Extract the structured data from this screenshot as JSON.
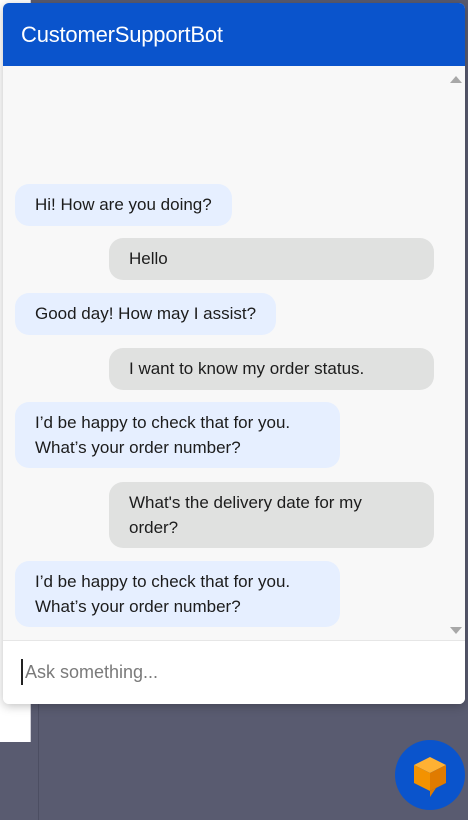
{
  "header": {
    "title": "CustomerSupportBot"
  },
  "messages": [
    {
      "sender": "bot",
      "text": "Hi! How are you doing?"
    },
    {
      "sender": "user",
      "text": "Hello"
    },
    {
      "sender": "bot",
      "text": "Good day! How may I assist?"
    },
    {
      "sender": "user",
      "text": "I want to know my order status."
    },
    {
      "sender": "bot",
      "text": "I’d be happy to check that for you. What’s your order number?"
    },
    {
      "sender": "user",
      "text": "What's the delivery date for my order?"
    },
    {
      "sender": "bot",
      "text": "I’d be happy to check that for you. What’s your order number?"
    }
  ],
  "input": {
    "placeholder": "Ask something..."
  },
  "launcher": {
    "icon": "chat-cube-icon"
  },
  "colors": {
    "header": "#0a54cc",
    "bot_bubble": "#e6efff",
    "user_bubble": "#e0e1e0",
    "launcher_icon": "#f39200"
  }
}
